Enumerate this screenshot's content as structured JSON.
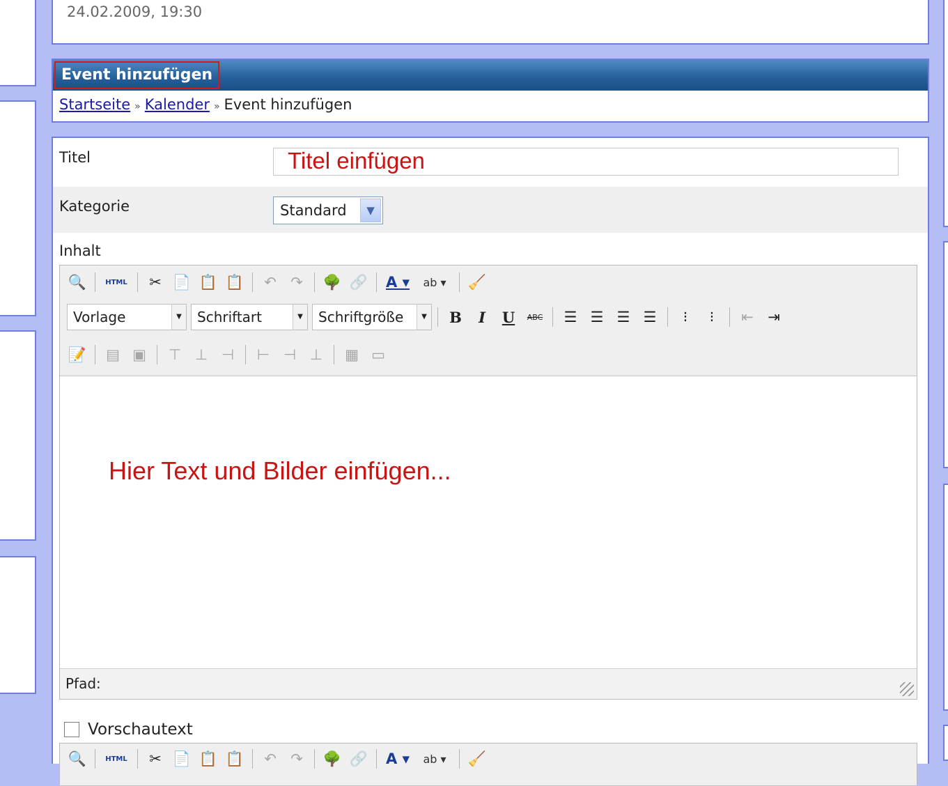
{
  "header": {
    "date": "24.02.2009, 19:30"
  },
  "section": {
    "title": "Event hinzufügen",
    "breadcrumb": {
      "home": "Startseite",
      "calendar": "Kalender",
      "current": "Event hinzufügen",
      "separator": "»"
    }
  },
  "form": {
    "title_label": "Titel",
    "title_value": "Titel einfügen",
    "category_label": "Kategorie",
    "category_value": "Standard",
    "content_label": "Inhalt",
    "editor_content": "Hier Text  und Bilder einfügen...",
    "status_path": "Pfad:",
    "preview_label": "Vorschautext"
  },
  "toolbar": {
    "row1": [
      "preview-icon",
      "html-icon",
      "cut-icon",
      "copy-icon",
      "paste-text-icon",
      "paste-word-icon",
      "undo-icon",
      "redo-icon",
      "image-icon",
      "link-icon",
      "font-color-icon",
      "highlight-icon",
      "cleanup-icon"
    ],
    "html_label": "HTML",
    "format_select": "Vorlage",
    "font_select": "Schriftart",
    "size_select": "Schriftgröße",
    "bold": "B",
    "italic": "I",
    "underline": "U",
    "strike": "ABC"
  },
  "colors": {
    "accent_red": "#c91414",
    "header_blue": "#245e9a",
    "page_bg": "#b5bdf5"
  }
}
